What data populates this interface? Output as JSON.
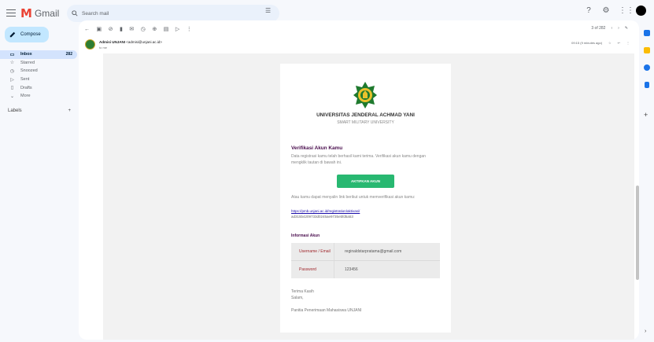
{
  "header": {
    "app_name": "Gmail",
    "search_placeholder": "Search mail"
  },
  "sidebar": {
    "compose_label": "Compose",
    "items": [
      {
        "label": "Inbox",
        "count": "282",
        "icon": "inbox-icon"
      },
      {
        "label": "Starred",
        "icon": "star-icon"
      },
      {
        "label": "Snoozed",
        "icon": "clock-icon"
      },
      {
        "label": "Sent",
        "icon": "send-icon"
      },
      {
        "label": "Drafts",
        "icon": "draft-icon"
      },
      {
        "label": "More",
        "icon": "chevron-down-icon"
      }
    ],
    "labels_heading": "Labels"
  },
  "message": {
    "sender": "Admisi UNJANI",
    "sender_email": "<admisi@unjani.ac.id>",
    "to": "to me",
    "date": "09:15 (9 minutes ago)",
    "pager": "3 of 282"
  },
  "email": {
    "university": "UNIVERSITAS JENDERAL ACHMAD YANI",
    "university_sub": "SMART MILITARY UNIVERSITY",
    "verify_title": "Verifikasi Akun Kamu",
    "verify_body": "Data registrasi kamu telah berhasil kami terima. Verifikasi akun kamu dengan mengklik tautan di bawah ini.",
    "activate_button": "AKTIFKAN AKUN",
    "alt_body": "Atau kamu dapat menyalin link berikut untuk memverifikasi akun kamu:",
    "link": "https://pmb.unjani.ac.id/registration/aktivasi/",
    "link_token": "ad315b4209733d0245ae9735ebfd5a53",
    "info_title": "Informasi Akun",
    "username_label": "Username / Email",
    "username_value": "reginaldstarpratama@gmail.com",
    "password_label": "Password",
    "password_value": "123456",
    "closing_1": "Terima Kasih",
    "closing_2": "Salam,",
    "signature": "Panitia Penerimaan Mahasiswa UNJANI"
  },
  "colors": {
    "accent_green": "#28b871",
    "title_purple": "#4a0e4e",
    "compose_bg": "#c2e7ff",
    "inbox_active": "#d3e3fd"
  }
}
